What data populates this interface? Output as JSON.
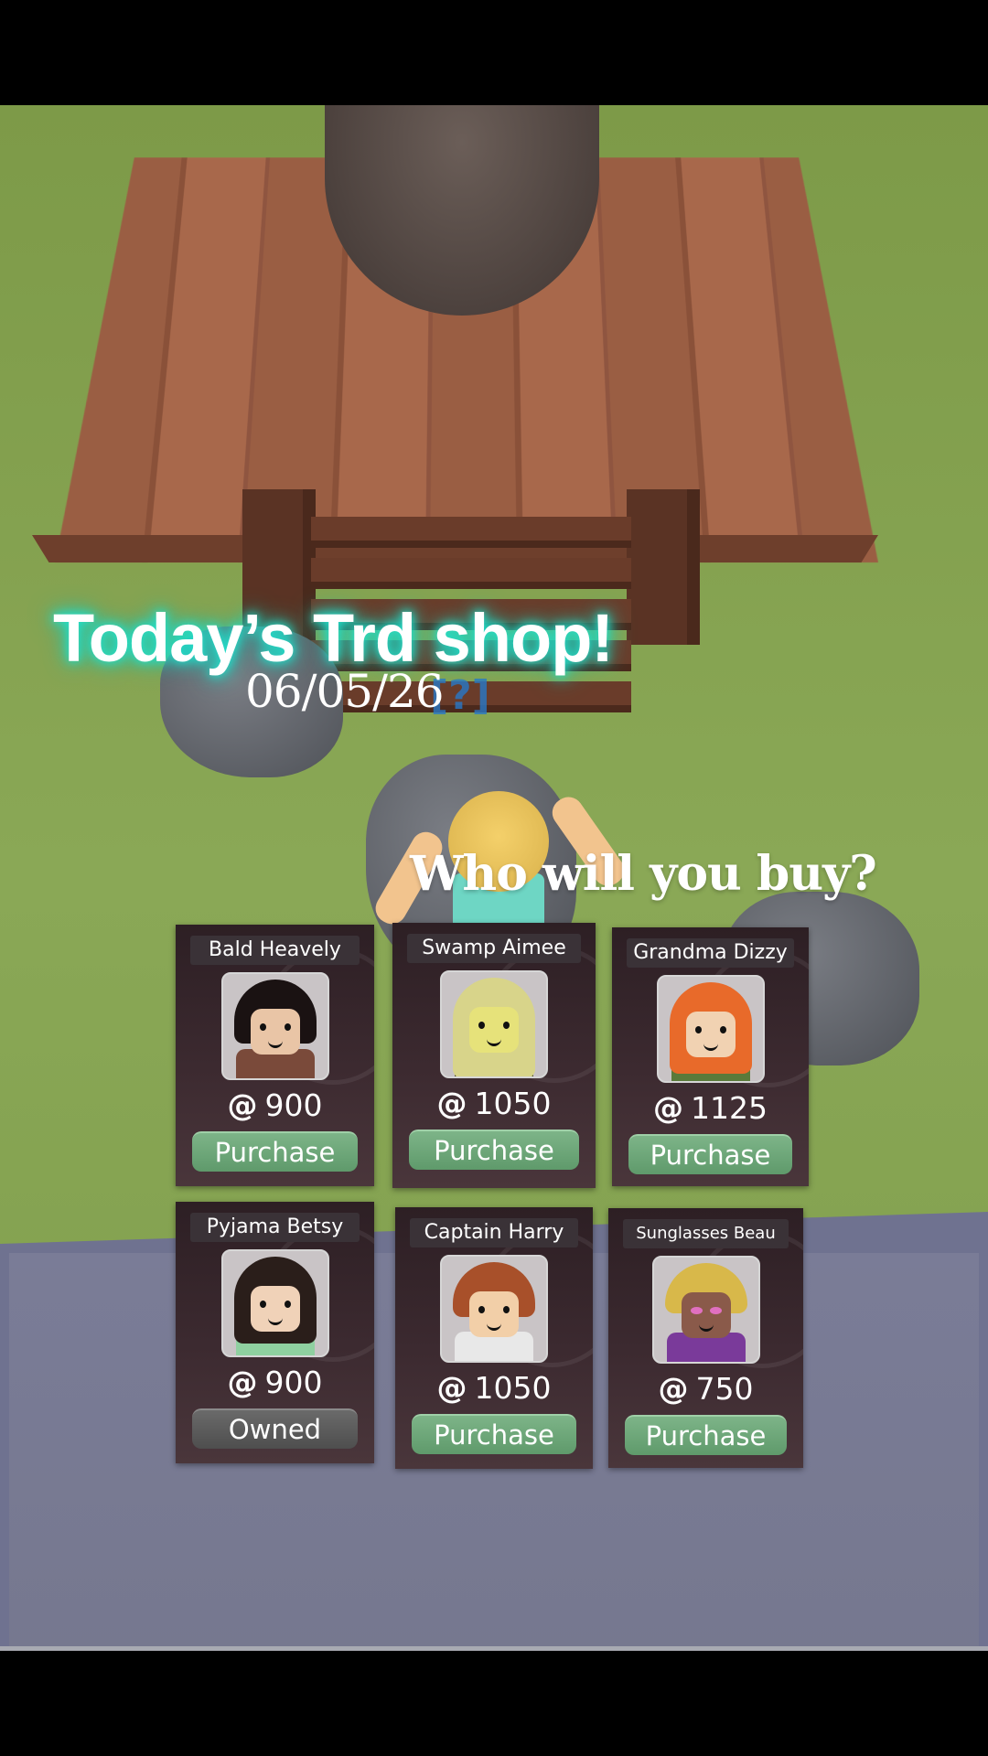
{
  "overlay": {
    "title": "Today’s Trd shop!",
    "date": "06/05/26",
    "question": "Who will you buy?"
  },
  "scene": {
    "player_tag": "[?]"
  },
  "shop": {
    "currency_icon": "@",
    "items": [
      {
        "name": "Bald Heavely",
        "price": "900",
        "button": "Purchase",
        "state": "purchase"
      },
      {
        "name": "Swamp Aimee",
        "price": "1050",
        "button": "Purchase",
        "state": "purchase"
      },
      {
        "name": "Grandma Dizzy",
        "price": "1125",
        "button": "Purchase",
        "state": "purchase"
      },
      {
        "name": "Pyjama Betsy",
        "price": "900",
        "button": "Owned",
        "state": "owned"
      },
      {
        "name": "Captain Harry",
        "price": "1050",
        "button": "Purchase",
        "state": "purchase"
      },
      {
        "name": "Sunglasses Beau",
        "price": "750",
        "button": "Purchase",
        "state": "purchase"
      }
    ]
  },
  "colors": {
    "title_glow": "#21e0cc",
    "purchase_button": "#6fa87a",
    "owned_button": "#5c5c5c",
    "card_bg": "#2d1f24"
  }
}
